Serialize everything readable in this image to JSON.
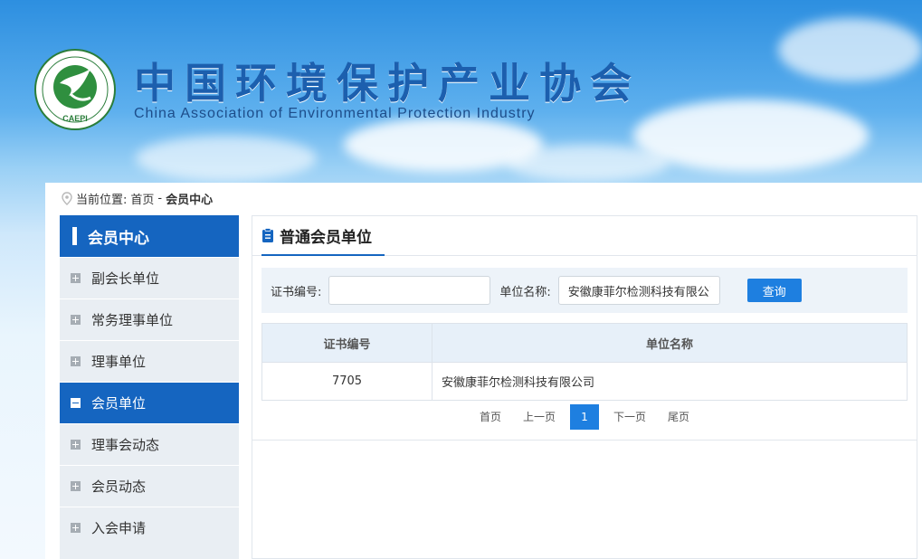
{
  "header": {
    "title_cn": "中国环境保护产业协会",
    "title_en": "China Association of Environmental Protection Industry",
    "logo_text": "CAEPI"
  },
  "breadcrumb": {
    "label": "当前位置:",
    "home": "首页",
    "separator": "-",
    "current": "会员中心"
  },
  "sidebar": {
    "title": "会员中心",
    "items": [
      {
        "label": "副会长单位",
        "active": false
      },
      {
        "label": "常务理事单位",
        "active": false
      },
      {
        "label": "理事单位",
        "active": false
      },
      {
        "label": "会员单位",
        "active": true
      },
      {
        "label": "理事会动态",
        "active": false
      },
      {
        "label": "会员动态",
        "active": false
      },
      {
        "label": "入会申请",
        "active": false
      }
    ]
  },
  "content": {
    "title": "普通会员单位",
    "search": {
      "cert_label": "证书编号:",
      "cert_value": "",
      "unit_label": "单位名称:",
      "unit_value": "安徽康菲尔检测科技有限公司",
      "button": "查询"
    },
    "table": {
      "headers": [
        "证书编号",
        "单位名称"
      ],
      "rows": [
        {
          "cert_no": "7705",
          "unit_name": "安徽康菲尔检测科技有限公司"
        }
      ]
    },
    "pager": {
      "first": "首页",
      "prev": "上一页",
      "current": "1",
      "next": "下一页",
      "last": "尾页"
    }
  },
  "colors": {
    "primary": "#1565c0",
    "button": "#1e7fe0",
    "sidebar_bg": "#e9eef3",
    "title": "#1c5fae"
  }
}
